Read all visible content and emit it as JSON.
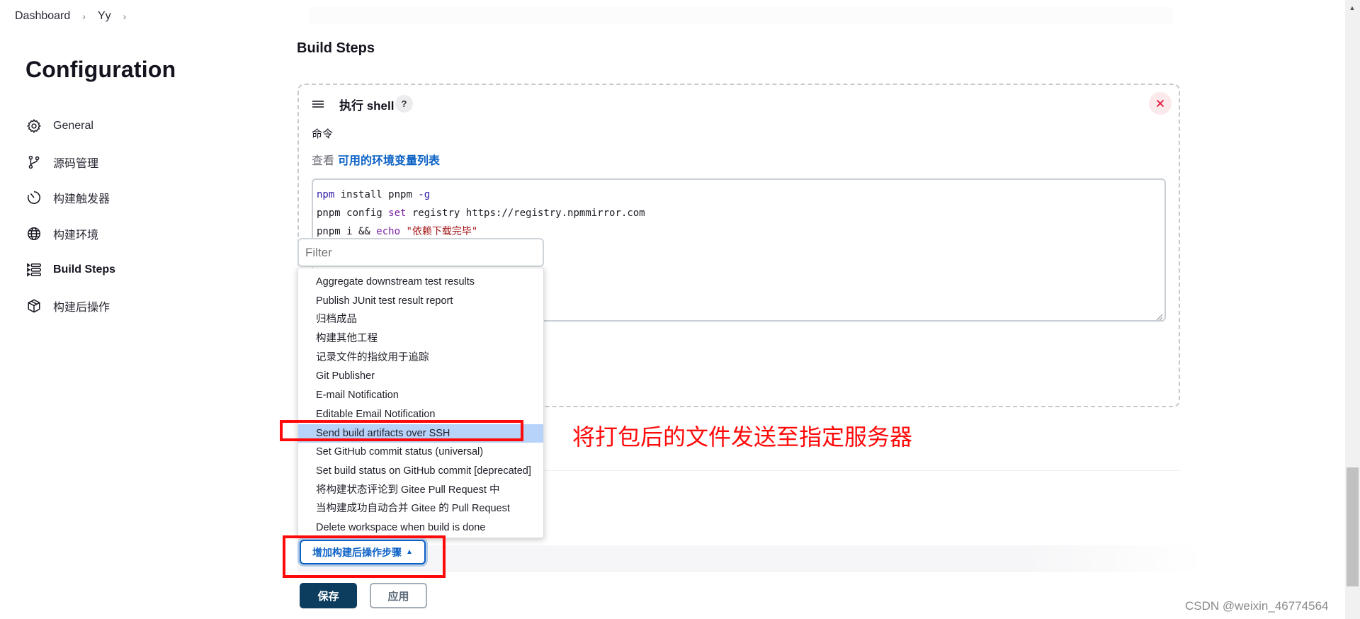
{
  "breadcrumb": {
    "items": [
      "Dashboard",
      "Yy"
    ],
    "separator": ">"
  },
  "page": {
    "title": "Configuration"
  },
  "sidebar": {
    "items": [
      {
        "label": "General",
        "icon": "gear-icon",
        "active": false
      },
      {
        "label": "源码管理",
        "icon": "git-branch-icon",
        "active": false
      },
      {
        "label": "构建触发器",
        "icon": "timer-icon",
        "active": false
      },
      {
        "label": "构建环境",
        "icon": "globe-icon",
        "active": false
      },
      {
        "label": "Build Steps",
        "icon": "list-steps-icon",
        "active": true
      },
      {
        "label": "构建后操作",
        "icon": "package-icon",
        "active": false
      }
    ]
  },
  "section": {
    "title": "Build Steps"
  },
  "step": {
    "title": "执行 shell",
    "help_label": "?",
    "close_label": "×",
    "command_label": "命令",
    "env_prefix": "查看",
    "env_link": "可用的环境变量列表",
    "code_lines": [
      {
        "parts": [
          {
            "t": "npm",
            "c": "kw-blue"
          },
          {
            "t": " install pnpm ",
            "c": ""
          },
          {
            "t": "-g",
            "c": "kw-blue"
          }
        ]
      },
      {
        "parts": [
          {
            "t": "pnpm config ",
            "c": ""
          },
          {
            "t": "set",
            "c": "kw-purple"
          },
          {
            "t": " registry https://registry.npmmirror.com",
            "c": ""
          }
        ]
      },
      {
        "parts": [
          {
            "t": "pnpm i && ",
            "c": ""
          },
          {
            "t": "echo",
            "c": "kw-purple"
          },
          {
            "t": " ",
            "c": ""
          },
          {
            "t": "\"依赖下载完毕\"",
            "c": "str-red"
          }
        ]
      }
    ]
  },
  "dropdown": {
    "filter_placeholder": "Filter",
    "highlighted_index": 8,
    "items": [
      "Aggregate downstream test results",
      "Publish JUnit test result report",
      "归档成品",
      "构建其他工程",
      "记录文件的指纹用于追踪",
      "Git Publisher",
      "E-mail Notification",
      "Editable Email Notification",
      "Send build artifacts over SSH",
      "Set GitHub commit status (universal)",
      "Set build status on GitHub commit [deprecated]",
      "将构建状态评论到 Gitee Pull Request 中",
      "当构建成功自动合并 Gitee 的 Pull Request",
      "Delete workspace when build is done"
    ]
  },
  "annotation": {
    "text": "将打包后的文件发送至指定服务器",
    "color": "#ff0a0a"
  },
  "actions": {
    "add_post_build_label": "增加构建后操作步骤",
    "add_caret": "▲",
    "save_label": "保存",
    "apply_label": "应用"
  },
  "watermark": "CSDN @weixin_46774564",
  "colors": {
    "accent": "#0b61c6",
    "primary_button": "#0c3d5f",
    "highlight": "#b7d3f9",
    "danger": "#e3183a"
  }
}
